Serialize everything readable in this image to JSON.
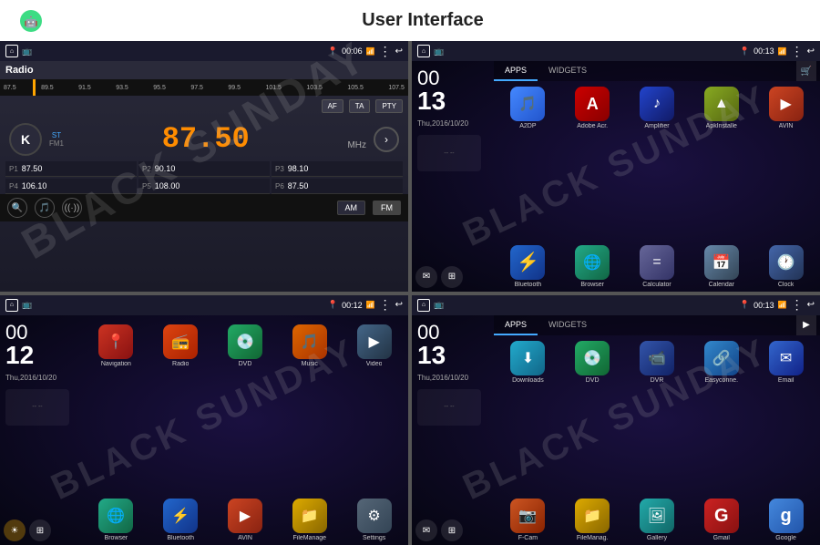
{
  "header": {
    "title": "User Interface"
  },
  "watermark": "BLACK SUNDAY",
  "panels": {
    "radio": {
      "title": "Radio",
      "time": "00:06",
      "freq_scale": [
        "87.5",
        "89.5",
        "91.5",
        "93.5",
        "95.5",
        "97.5",
        "99.5",
        "101.5",
        "103.5",
        "105.5",
        "107.5"
      ],
      "buttons": [
        "AF",
        "TA",
        "PTY"
      ],
      "k_label": "K",
      "st_label": "ST",
      "fm_label": "FM1",
      "frequency": "87.50",
      "mhz": "MHz",
      "presets": [
        {
          "label": "P1",
          "freq": "87.50"
        },
        {
          "label": "P2",
          "freq": "90.10"
        },
        {
          "label": "P3",
          "freq": "98.10"
        },
        {
          "label": "P4",
          "freq": "106.10"
        },
        {
          "label": "P5",
          "freq": "108.00"
        },
        {
          "label": "P6",
          "freq": "87.50"
        }
      ],
      "modes": [
        "AM",
        "FM"
      ]
    },
    "apps1": {
      "time": "00 13",
      "date": "Thu,2016/10/20",
      "tabs": [
        "APPS",
        "WIDGETS"
      ],
      "active_tab": "APPS",
      "icons_row1": [
        {
          "label": "A2DP",
          "class": "ic-a2dp",
          "icon": "🎵"
        },
        {
          "label": "Adobe Acr.",
          "class": "ic-adobe",
          "icon": "A"
        },
        {
          "label": "Amplifier",
          "class": "ic-amplifier",
          "icon": "♪"
        },
        {
          "label": "ApkInstalle",
          "class": "ic-apk",
          "icon": "▲"
        },
        {
          "label": "AVIN",
          "class": "ic-avin",
          "icon": "▶"
        }
      ],
      "icons_row2": [
        {
          "label": "Bluetooth",
          "class": "ic-bluetooth",
          "icon": "⚡"
        },
        {
          "label": "Browser",
          "class": "ic-browser",
          "icon": "🌐"
        },
        {
          "label": "Calculator",
          "class": "ic-calculator",
          "icon": "="
        },
        {
          "label": "Calendar",
          "class": "ic-calendar",
          "icon": "📅"
        },
        {
          "label": "Clock",
          "class": "ic-clock",
          "icon": "🕐"
        }
      ]
    },
    "home": {
      "time": "00 12",
      "date": "Thu,2016/10/20",
      "time_status": "00:12",
      "icons": [
        {
          "label": "Navigation",
          "class": "ic-navigation",
          "icon": "📍"
        },
        {
          "label": "Radio",
          "class": "ic-radio",
          "icon": "📻"
        },
        {
          "label": "DVD",
          "class": "ic-dvd",
          "icon": "💿"
        },
        {
          "label": "Music",
          "class": "ic-music",
          "icon": "🎵"
        },
        {
          "label": "Video",
          "class": "ic-video",
          "icon": "▶"
        }
      ],
      "icons2": [
        {
          "label": "Browser",
          "class": "ic-browser",
          "icon": "🌐"
        },
        {
          "label": "Bluetooth",
          "class": "ic-bluetooth",
          "icon": "⚡"
        },
        {
          "label": "AVIN",
          "class": "ic-avin",
          "icon": "▶"
        },
        {
          "label": "FileManage",
          "class": "ic-filemanager",
          "icon": "📁"
        },
        {
          "label": "Settings",
          "class": "ic-settings",
          "icon": "⚙"
        }
      ]
    },
    "apps2": {
      "time": "00 13",
      "date": "Thu,2016/10/20",
      "time_status": "00:13",
      "tabs": [
        "APPS",
        "WIDGETS"
      ],
      "active_tab": "APPS",
      "icons_row1": [
        {
          "label": "Downloads",
          "class": "ic-downloads",
          "icon": "⬇"
        },
        {
          "label": "DVD",
          "class": "ic-dvd",
          "icon": "💿"
        },
        {
          "label": "DVR",
          "class": "ic-dvr",
          "icon": "📹"
        },
        {
          "label": "Easyconne.",
          "class": "ic-easyconnect",
          "icon": "🔗"
        },
        {
          "label": "Email",
          "class": "ic-email",
          "icon": "✉"
        }
      ],
      "icons_row2": [
        {
          "label": "F-Cam",
          "class": "ic-fcam",
          "icon": "📷"
        },
        {
          "label": "FileManag.",
          "class": "ic-filemanager",
          "icon": "📁"
        },
        {
          "label": "Gallery",
          "class": "ic-gallery",
          "icon": "🖼"
        },
        {
          "label": "Gmail",
          "class": "ic-gmail",
          "icon": "G"
        },
        {
          "label": "Google",
          "class": "ic-google",
          "icon": "g"
        }
      ]
    }
  }
}
